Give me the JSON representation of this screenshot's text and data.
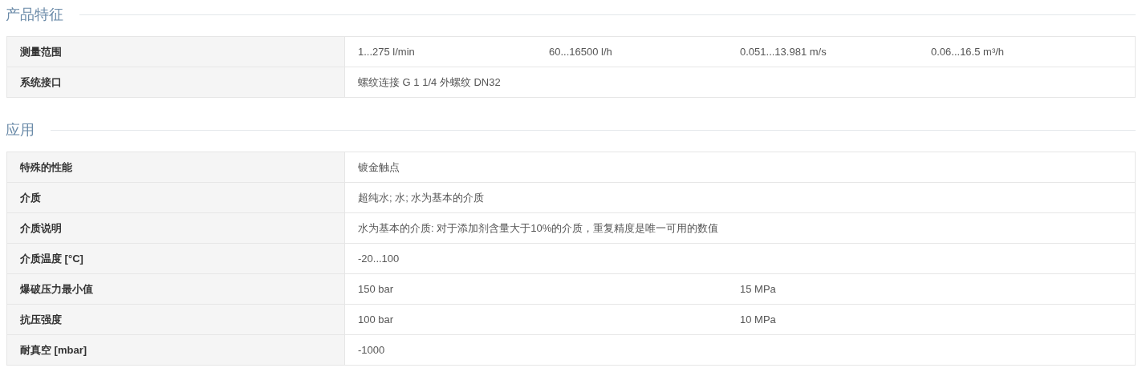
{
  "sections": [
    {
      "title": "产品特征",
      "rows": [
        {
          "label": "测量范围",
          "values": [
            "1...275 l/min",
            "60...16500 l/h",
            "0.051...13.981 m/s",
            "0.06...16.5 m³/h"
          ]
        },
        {
          "label": "系统接口",
          "values": [
            "螺纹连接 G 1 1/4 外螺纹 DN32"
          ]
        }
      ]
    },
    {
      "title": "应用",
      "rows": [
        {
          "label": "特殊的性能",
          "values": [
            "镀金触点"
          ]
        },
        {
          "label": "介质",
          "values": [
            "超纯水; 水; 水为基本的介质"
          ]
        },
        {
          "label": "介质说明",
          "values": [
            "水为基本的介质: 对于添加剂含量大于10%的介质，重复精度是唯一可用的数值"
          ]
        },
        {
          "label": "介质温度 [°C]",
          "values": [
            "-20...100"
          ]
        },
        {
          "label": "爆破压力最小值",
          "values": [
            "150 bar",
            "15 MPa"
          ]
        },
        {
          "label": "抗压强度",
          "values": [
            "100 bar",
            "10 MPa"
          ]
        },
        {
          "label": "耐真空 [mbar]",
          "values": [
            "-1000"
          ]
        }
      ]
    }
  ]
}
